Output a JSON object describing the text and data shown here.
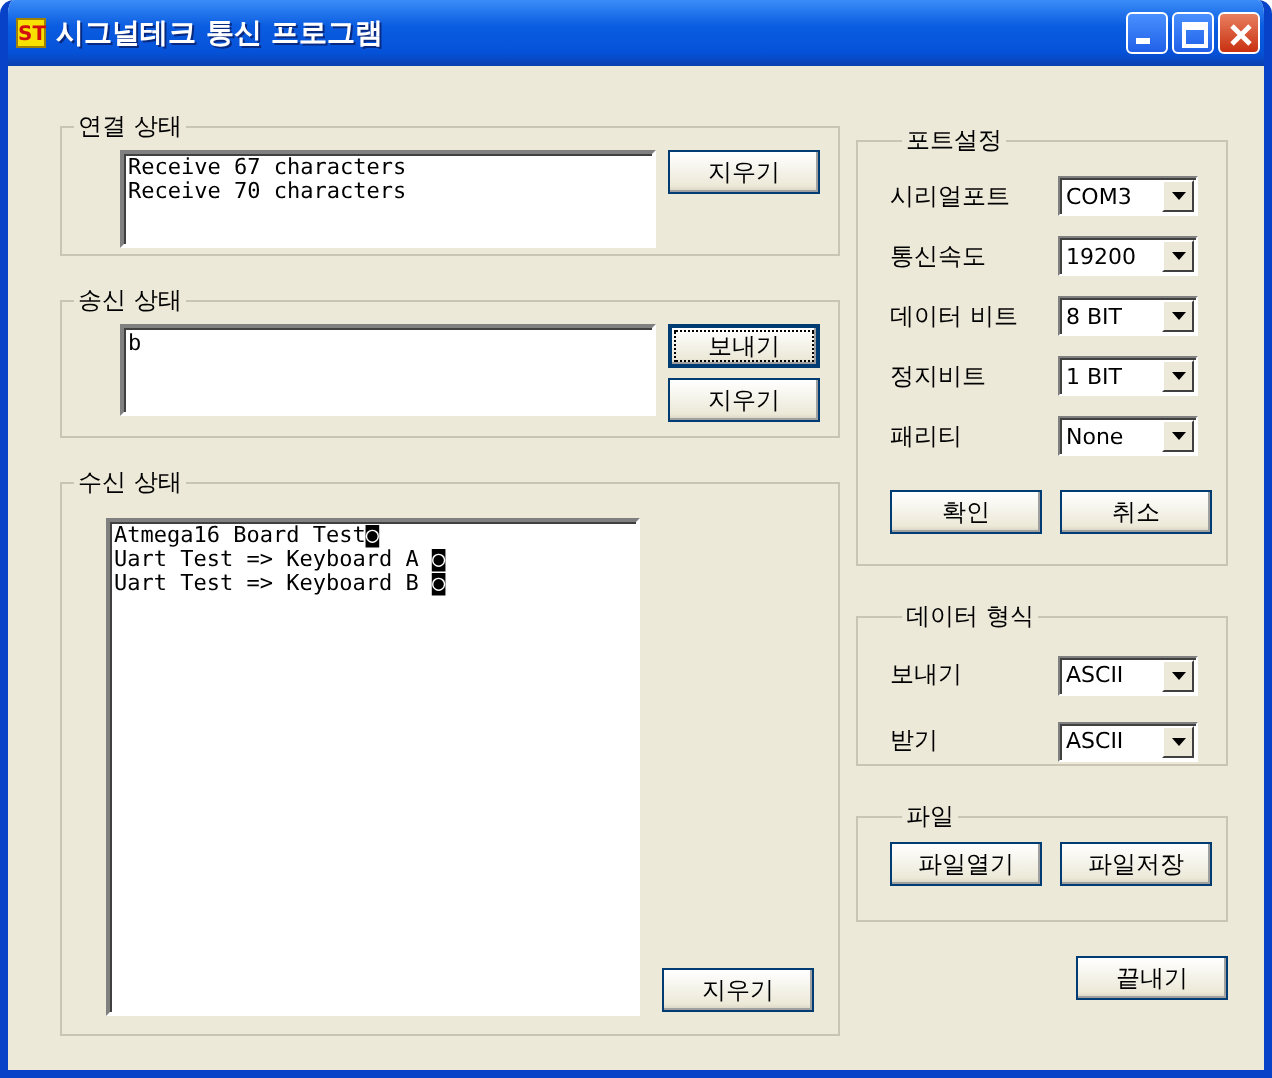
{
  "window": {
    "title": "시그널테크 통신 프로그램",
    "icon_text": "ST"
  },
  "connection": {
    "title": "연결 상태",
    "lines": [
      "Receive 67 characters",
      "Receive 70 characters"
    ],
    "buttons": [
      {
        "label": "지우기",
        "focused": false
      }
    ]
  },
  "send": {
    "title": "송신 상태",
    "value": "b",
    "buttons": [
      {
        "label": "보내기",
        "focused": true
      },
      {
        "label": "지우기",
        "focused": false
      }
    ]
  },
  "receive": {
    "title": "수신 상태",
    "lines": [
      "Atmega16 Board Test◙",
      "Uart Test => Keyboard A ◙",
      "Uart Test => Keyboard B ◙"
    ],
    "buttons": [
      {
        "label": "지우기",
        "focused": false
      }
    ]
  },
  "port": {
    "title": "포트설정",
    "rows": [
      {
        "label": "시리얼포트",
        "value": "COM3"
      },
      {
        "label": "통신속도",
        "value": "19200"
      },
      {
        "label": "데이터 비트",
        "value": "8 BIT"
      },
      {
        "label": "정지비트",
        "value": "1 BIT"
      },
      {
        "label": "패리티",
        "value": "None"
      }
    ],
    "buttons": [
      {
        "label": "확인",
        "focused": false
      },
      {
        "label": "취소",
        "focused": false
      }
    ]
  },
  "format": {
    "title": "데이터 형식",
    "rows": [
      {
        "label": "보내기",
        "value": "ASCII"
      },
      {
        "label": "받기",
        "value": "ASCII"
      }
    ]
  },
  "file": {
    "title": "파일",
    "buttons": [
      {
        "label": "파일열기",
        "focused": false
      },
      {
        "label": "파일저장",
        "focused": false
      }
    ]
  },
  "exit": {
    "label": "끝내기",
    "focused": false
  }
}
